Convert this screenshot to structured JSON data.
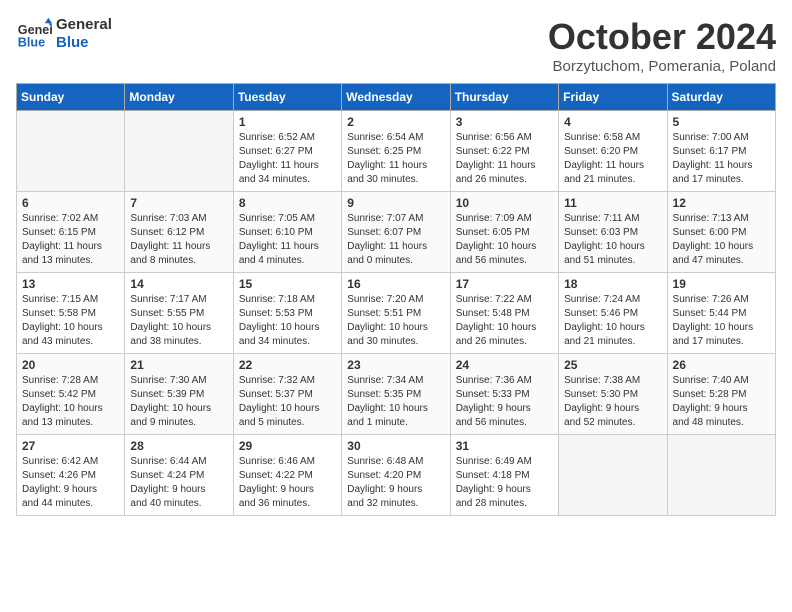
{
  "logo": {
    "line1": "General",
    "line2": "Blue"
  },
  "title": "October 2024",
  "subtitle": "Borzytuchom, Pomerania, Poland",
  "days_header": [
    "Sunday",
    "Monday",
    "Tuesday",
    "Wednesday",
    "Thursday",
    "Friday",
    "Saturday"
  ],
  "weeks": [
    [
      {
        "num": "",
        "info": ""
      },
      {
        "num": "",
        "info": ""
      },
      {
        "num": "1",
        "info": "Sunrise: 6:52 AM\nSunset: 6:27 PM\nDaylight: 11 hours\nand 34 minutes."
      },
      {
        "num": "2",
        "info": "Sunrise: 6:54 AM\nSunset: 6:25 PM\nDaylight: 11 hours\nand 30 minutes."
      },
      {
        "num": "3",
        "info": "Sunrise: 6:56 AM\nSunset: 6:22 PM\nDaylight: 11 hours\nand 26 minutes."
      },
      {
        "num": "4",
        "info": "Sunrise: 6:58 AM\nSunset: 6:20 PM\nDaylight: 11 hours\nand 21 minutes."
      },
      {
        "num": "5",
        "info": "Sunrise: 7:00 AM\nSunset: 6:17 PM\nDaylight: 11 hours\nand 17 minutes."
      }
    ],
    [
      {
        "num": "6",
        "info": "Sunrise: 7:02 AM\nSunset: 6:15 PM\nDaylight: 11 hours\nand 13 minutes."
      },
      {
        "num": "7",
        "info": "Sunrise: 7:03 AM\nSunset: 6:12 PM\nDaylight: 11 hours\nand 8 minutes."
      },
      {
        "num": "8",
        "info": "Sunrise: 7:05 AM\nSunset: 6:10 PM\nDaylight: 11 hours\nand 4 minutes."
      },
      {
        "num": "9",
        "info": "Sunrise: 7:07 AM\nSunset: 6:07 PM\nDaylight: 11 hours\nand 0 minutes."
      },
      {
        "num": "10",
        "info": "Sunrise: 7:09 AM\nSunset: 6:05 PM\nDaylight: 10 hours\nand 56 minutes."
      },
      {
        "num": "11",
        "info": "Sunrise: 7:11 AM\nSunset: 6:03 PM\nDaylight: 10 hours\nand 51 minutes."
      },
      {
        "num": "12",
        "info": "Sunrise: 7:13 AM\nSunset: 6:00 PM\nDaylight: 10 hours\nand 47 minutes."
      }
    ],
    [
      {
        "num": "13",
        "info": "Sunrise: 7:15 AM\nSunset: 5:58 PM\nDaylight: 10 hours\nand 43 minutes."
      },
      {
        "num": "14",
        "info": "Sunrise: 7:17 AM\nSunset: 5:55 PM\nDaylight: 10 hours\nand 38 minutes."
      },
      {
        "num": "15",
        "info": "Sunrise: 7:18 AM\nSunset: 5:53 PM\nDaylight: 10 hours\nand 34 minutes."
      },
      {
        "num": "16",
        "info": "Sunrise: 7:20 AM\nSunset: 5:51 PM\nDaylight: 10 hours\nand 30 minutes."
      },
      {
        "num": "17",
        "info": "Sunrise: 7:22 AM\nSunset: 5:48 PM\nDaylight: 10 hours\nand 26 minutes."
      },
      {
        "num": "18",
        "info": "Sunrise: 7:24 AM\nSunset: 5:46 PM\nDaylight: 10 hours\nand 21 minutes."
      },
      {
        "num": "19",
        "info": "Sunrise: 7:26 AM\nSunset: 5:44 PM\nDaylight: 10 hours\nand 17 minutes."
      }
    ],
    [
      {
        "num": "20",
        "info": "Sunrise: 7:28 AM\nSunset: 5:42 PM\nDaylight: 10 hours\nand 13 minutes."
      },
      {
        "num": "21",
        "info": "Sunrise: 7:30 AM\nSunset: 5:39 PM\nDaylight: 10 hours\nand 9 minutes."
      },
      {
        "num": "22",
        "info": "Sunrise: 7:32 AM\nSunset: 5:37 PM\nDaylight: 10 hours\nand 5 minutes."
      },
      {
        "num": "23",
        "info": "Sunrise: 7:34 AM\nSunset: 5:35 PM\nDaylight: 10 hours\nand 1 minute."
      },
      {
        "num": "24",
        "info": "Sunrise: 7:36 AM\nSunset: 5:33 PM\nDaylight: 9 hours\nand 56 minutes."
      },
      {
        "num": "25",
        "info": "Sunrise: 7:38 AM\nSunset: 5:30 PM\nDaylight: 9 hours\nand 52 minutes."
      },
      {
        "num": "26",
        "info": "Sunrise: 7:40 AM\nSunset: 5:28 PM\nDaylight: 9 hours\nand 48 minutes."
      }
    ],
    [
      {
        "num": "27",
        "info": "Sunrise: 6:42 AM\nSunset: 4:26 PM\nDaylight: 9 hours\nand 44 minutes."
      },
      {
        "num": "28",
        "info": "Sunrise: 6:44 AM\nSunset: 4:24 PM\nDaylight: 9 hours\nand 40 minutes."
      },
      {
        "num": "29",
        "info": "Sunrise: 6:46 AM\nSunset: 4:22 PM\nDaylight: 9 hours\nand 36 minutes."
      },
      {
        "num": "30",
        "info": "Sunrise: 6:48 AM\nSunset: 4:20 PM\nDaylight: 9 hours\nand 32 minutes."
      },
      {
        "num": "31",
        "info": "Sunrise: 6:49 AM\nSunset: 4:18 PM\nDaylight: 9 hours\nand 28 minutes."
      },
      {
        "num": "",
        "info": ""
      },
      {
        "num": "",
        "info": ""
      }
    ]
  ]
}
